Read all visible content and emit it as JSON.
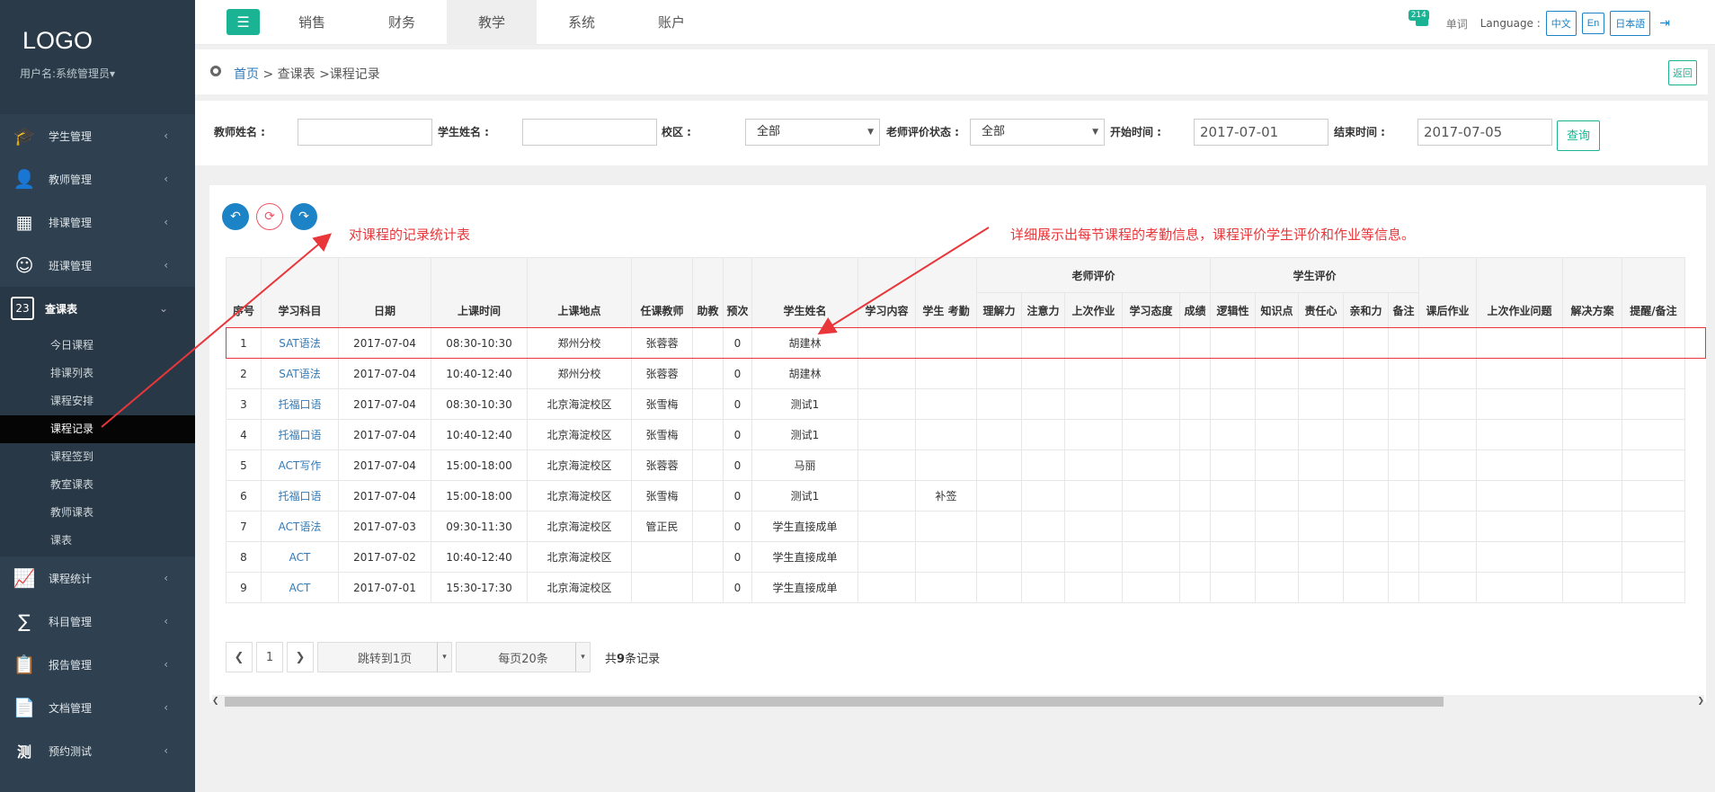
{
  "sidebar": {
    "logo": "LOGO",
    "user": "用户名:系统管理员▾",
    "items": [
      {
        "label": "学生管理",
        "icon": "graduation-cap-icon",
        "glyph": "🎓"
      },
      {
        "label": "教师管理",
        "icon": "teacher-icon",
        "glyph": "👤"
      },
      {
        "label": "排课管理",
        "icon": "grid-icon",
        "glyph": "▦"
      },
      {
        "label": "班课管理",
        "icon": "mask-icon",
        "glyph": "☺"
      },
      {
        "label": "查课表",
        "icon": "calendar-icon",
        "glyph": "23"
      },
      {
        "label": "课程统计",
        "icon": "chart-icon",
        "glyph": "📈"
      },
      {
        "label": "科目管理",
        "icon": "formula-icon",
        "glyph": "∑"
      },
      {
        "label": "报告管理",
        "icon": "clipboard-icon",
        "glyph": "📋"
      },
      {
        "label": "文档管理",
        "icon": "document-icon",
        "glyph": "📄"
      },
      {
        "label": "预约测试",
        "icon": "test-icon",
        "glyph": "测"
      }
    ],
    "submenu": [
      "今日课程",
      "排课列表",
      "课程安排",
      "课程记录",
      "课程签到",
      "教室课表",
      "教师课表",
      "课表"
    ]
  },
  "topbar": {
    "tabs": [
      "销售",
      "财务",
      "教学",
      "系统",
      "账户"
    ],
    "badge": "214",
    "words": "单词",
    "language_label": "Language :",
    "langs": [
      "中文",
      "En",
      "日本語"
    ]
  },
  "breadcrumb": {
    "home": "首页",
    "rest": " > 查课表 >课程记录",
    "back": "返回"
  },
  "filter": {
    "teacher_label": "教师姓名 :",
    "student_label": "学生姓名 :",
    "campus_label": "校区 :",
    "campus_value": "全部",
    "eval_label": "老师评价状态 :",
    "eval_value": "全部",
    "start_label": "开始时间 :",
    "start_value": "2017-07-01",
    "end_label": "结束时间 :",
    "end_value": "2017-07-05",
    "query": "查询"
  },
  "annotations": {
    "left": "对课程的记录统计表",
    "right": "详细展示出每节课程的考勤信息，课程评价学生评价和作业等信息。"
  },
  "table": {
    "group_teacher": "老师评价",
    "group_student": "学生评价",
    "headers": [
      "序号",
      "学习科目",
      "日期",
      "上课时间",
      "上课地点",
      "任课教师",
      "助教",
      "预次",
      "学生姓名",
      "学习内容",
      "学生 考勤",
      "理解力",
      "注意力",
      "上次作业",
      "学习态度",
      "成绩",
      "逻辑性",
      "知识点",
      "责任心",
      "亲和力",
      "备注",
      "课后作业",
      "上次作业问题",
      "解决方案",
      "提醒/备注"
    ],
    "rows": [
      [
        "1",
        "SAT语法",
        "2017-07-04",
        "08:30-10:30",
        "郑州分校",
        "张蓉蓉",
        "",
        "0",
        "胡建林",
        "",
        "",
        "",
        "",
        "",
        "",
        "",
        "",
        "",
        "",
        "",
        "",
        "",
        "",
        "",
        ""
      ],
      [
        "2",
        "SAT语法",
        "2017-07-04",
        "10:40-12:40",
        "郑州分校",
        "张蓉蓉",
        "",
        "0",
        "胡建林",
        "",
        "",
        "",
        "",
        "",
        "",
        "",
        "",
        "",
        "",
        "",
        "",
        "",
        "",
        "",
        ""
      ],
      [
        "3",
        "托福口语",
        "2017-07-04",
        "08:30-10:30",
        "北京海淀校区",
        "张雪梅",
        "",
        "0",
        "测试1",
        "",
        "",
        "",
        "",
        "",
        "",
        "",
        "",
        "",
        "",
        "",
        "",
        "",
        "",
        "",
        ""
      ],
      [
        "4",
        "托福口语",
        "2017-07-04",
        "10:40-12:40",
        "北京海淀校区",
        "张雪梅",
        "",
        "0",
        "测试1",
        "",
        "",
        "",
        "",
        "",
        "",
        "",
        "",
        "",
        "",
        "",
        "",
        "",
        "",
        "",
        ""
      ],
      [
        "5",
        "ACT写作",
        "2017-07-04",
        "15:00-18:00",
        "北京海淀校区",
        "张蓉蓉",
        "",
        "0",
        "马丽",
        "",
        "",
        "",
        "",
        "",
        "",
        "",
        "",
        "",
        "",
        "",
        "",
        "",
        "",
        "",
        ""
      ],
      [
        "6",
        "托福口语",
        "2017-07-04",
        "15:00-18:00",
        "北京海淀校区",
        "张雪梅",
        "",
        "0",
        "测试1",
        "",
        "补签",
        "",
        "",
        "",
        "",
        "",
        "",
        "",
        "",
        "",
        "",
        "",
        "",
        "",
        ""
      ],
      [
        "7",
        "ACT语法",
        "2017-07-03",
        "09:30-11:30",
        "北京海淀校区",
        "管正民",
        "",
        "0",
        "学生直接成单",
        "",
        "",
        "",
        "",
        "",
        "",
        "",
        "",
        "",
        "",
        "",
        "",
        "",
        "",
        "",
        ""
      ],
      [
        "8",
        "ACT",
        "2017-07-02",
        "10:40-12:40",
        "北京海淀校区",
        "",
        "",
        "0",
        "学生直接成单",
        "",
        "",
        "",
        "",
        "",
        "",
        "",
        "",
        "",
        "",
        "",
        "",
        "",
        "",
        "",
        ""
      ],
      [
        "9",
        "ACT",
        "2017-07-01",
        "15:30-17:30",
        "北京海淀校区",
        "",
        "",
        "0",
        "学生直接成单",
        "",
        "",
        "",
        "",
        "",
        "",
        "",
        "",
        "",
        "",
        "",
        "",
        "",
        "",
        "",
        ""
      ]
    ]
  },
  "pager": {
    "page": "1",
    "jump": "跳转到1页",
    "per_page": "每页20条",
    "total_prefix": "共",
    "total_count": "9",
    "total_suffix": "条记录"
  },
  "colors": {
    "accent": "#1ab394",
    "link": "#337ab7",
    "annotation": "#e8363a",
    "sidebar": "#2f4050"
  }
}
